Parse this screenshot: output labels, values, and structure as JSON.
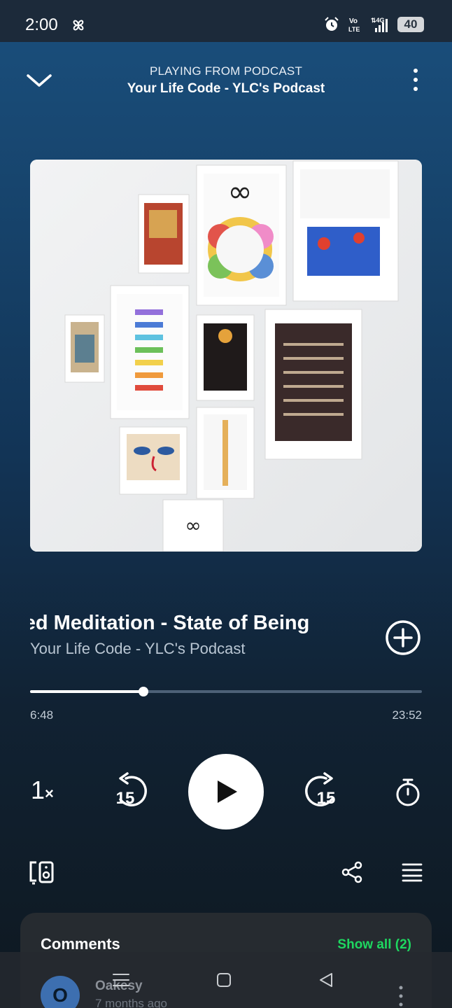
{
  "status_bar": {
    "time": "2:00",
    "battery": "40",
    "icons": [
      "pinwheel-icon",
      "alarm-icon",
      "volte-icon",
      "signal-4g-icon",
      "battery-icon"
    ]
  },
  "header": {
    "context_label": "PLAYING FROM PODCAST",
    "context_title": "Your Life Code - YLC's Podcast"
  },
  "track": {
    "title": "ded Meditation - State of Being",
    "show": "Your Life Code - YLC's Podcast",
    "progress_fraction": 0.29,
    "elapsed": "6:48",
    "total": "23:52"
  },
  "controls": {
    "speed": "1",
    "speed_suffix": "×",
    "rewind_seconds": "15",
    "forward_seconds": "15"
  },
  "comments": {
    "title": "Comments",
    "show_all": "Show all (2)",
    "first": {
      "avatar_letter": "O",
      "author": "Oakesy",
      "time": "7 months ago"
    }
  },
  "colors": {
    "accent": "#1ed760",
    "background_top": "#1a4f7d",
    "background_bottom": "#0e1820"
  }
}
